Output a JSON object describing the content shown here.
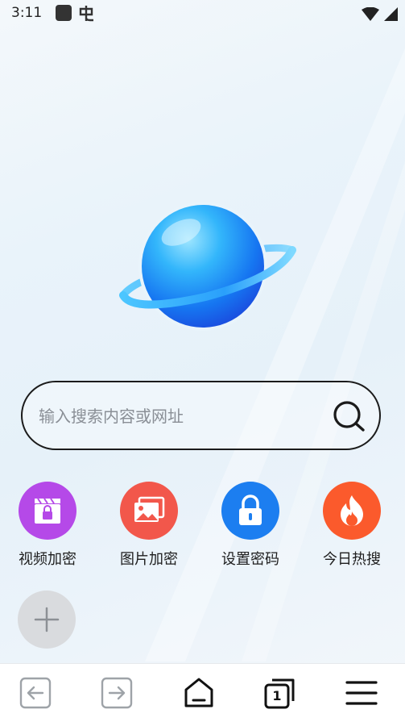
{
  "status_bar": {
    "time": "3:11",
    "icons": [
      "app-square-icon",
      "app-glyph-icon",
      "wifi-icon",
      "cell-signal-icon"
    ]
  },
  "logo": {
    "icon": "planet-logo-icon"
  },
  "search": {
    "placeholder": "输入搜索内容或网址",
    "value": "",
    "icon": "search-icon"
  },
  "shortcuts": [
    {
      "label": "视频加密",
      "icon": "video-lock-icon",
      "color": "#b549e8"
    },
    {
      "label": "图片加密",
      "icon": "image-icon",
      "color": "#f2574b"
    },
    {
      "label": "设置密码",
      "icon": "lock-icon",
      "color": "#1c7ef0"
    },
    {
      "label": "今日热搜",
      "icon": "flame-icon",
      "color": "#fb5a2c"
    }
  ],
  "add_button": {
    "icon": "plus-icon",
    "color": "#d9dbde"
  },
  "bottom_nav": {
    "items": [
      {
        "name": "back",
        "icon": "arrow-left-icon",
        "enabled": false
      },
      {
        "name": "forward",
        "icon": "arrow-right-icon",
        "enabled": false
      },
      {
        "name": "home",
        "icon": "home-icon",
        "enabled": true
      },
      {
        "name": "tabs",
        "icon": "tabs-icon",
        "enabled": true
      },
      {
        "name": "menu",
        "icon": "menu-icon",
        "enabled": true
      }
    ],
    "tab_count": "1"
  },
  "colors": {
    "accent": "#1c7ef0",
    "text": "#1e1e1e",
    "placeholder": "#8a8f96",
    "disabled_icon": "#9ea3a8"
  }
}
